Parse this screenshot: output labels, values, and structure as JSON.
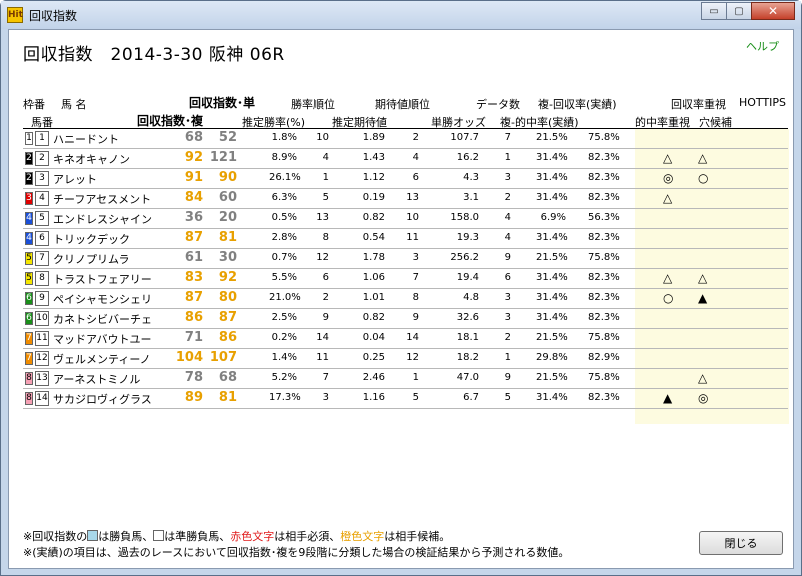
{
  "window": {
    "title": "回収指数",
    "app_icon_text": "Hit"
  },
  "header": {
    "title": "回収指数　2014-3-30 阪神 06R",
    "help": "ヘルプ"
  },
  "columns": {
    "waku": "枠番",
    "uma": "馬 名",
    "umaban": "馬番",
    "idx_single": "回収指数･単",
    "idx_place": "回収指数･複",
    "win_rank": "勝率順位",
    "exp_rank": "期待値順位",
    "data_count": "データ数",
    "place_return": "複-回収率(実績)",
    "est_win": "推定勝率(%)",
    "est_exp": "推定期待値",
    "win_odds": "単勝オッズ",
    "place_hit": "複-的中率(実績)",
    "return_focus": "回収率重視",
    "hit_focus": "的中率重視",
    "hottips": "HOTTIPS",
    "longshot": "穴候補"
  },
  "colors": {
    "orange": "#e8a000",
    "gray": "#808080",
    "red": "#e01a1a",
    "highlight_bg": "#fdfbe0"
  },
  "rows": [
    {
      "waku": "1",
      "uma": "1",
      "name": "ハニードント",
      "i1": "68",
      "i2": "52",
      "c1": "gray",
      "c2": "gray",
      "rate": "1.8%",
      "rk": "10",
      "exp": "1.89",
      "erk": "2",
      "odds": "107.7",
      "ork": "7",
      "fh": "21.5%",
      "wh": "75.8%",
      "m1": "",
      "m2": ""
    },
    {
      "waku": "2",
      "uma": "2",
      "name": "キネオキャノン",
      "i1": "92",
      "i2": "121",
      "c1": "orange",
      "c2": "gray",
      "rate": "8.9%",
      "rk": "4",
      "exp": "1.43",
      "erk": "4",
      "odds": "16.2",
      "ork": "1",
      "fh": "31.4%",
      "wh": "82.3%",
      "m1": "△",
      "m2": "△"
    },
    {
      "waku": "2",
      "uma": "3",
      "name": "アレット",
      "i1": "91",
      "i2": "90",
      "c1": "orange",
      "c2": "orange",
      "rate": "26.1%",
      "rk": "1",
      "exp": "1.12",
      "erk": "6",
      "odds": "4.3",
      "ork": "3",
      "fh": "31.4%",
      "wh": "82.3%",
      "m1": "◎",
      "m2": "○"
    },
    {
      "waku": "3",
      "uma": "4",
      "name": "チーフアセスメント",
      "i1": "84",
      "i2": "60",
      "c1": "orange",
      "c2": "gray",
      "rate": "6.3%",
      "rk": "5",
      "exp": "0.19",
      "erk": "13",
      "odds": "3.1",
      "ork": "2",
      "fh": "31.4%",
      "wh": "82.3%",
      "m1": "△",
      "m2": ""
    },
    {
      "waku": "4",
      "uma": "5",
      "name": "エンドレスシャイン",
      "i1": "36",
      "i2": "20",
      "c1": "gray",
      "c2": "gray",
      "rate": "0.5%",
      "rk": "13",
      "exp": "0.82",
      "erk": "10",
      "odds": "158.0",
      "ork": "4",
      "fh": "6.9%",
      "wh": "56.3%",
      "m1": "",
      "m2": ""
    },
    {
      "waku": "4",
      "uma": "6",
      "name": "トリックデック",
      "i1": "87",
      "i2": "81",
      "c1": "orange",
      "c2": "orange",
      "rate": "2.8%",
      "rk": "8",
      "exp": "0.54",
      "erk": "11",
      "odds": "19.3",
      "ork": "4",
      "fh": "31.4%",
      "wh": "82.3%",
      "m1": "",
      "m2": ""
    },
    {
      "waku": "5",
      "uma": "7",
      "name": "クリノプリムラ",
      "i1": "61",
      "i2": "30",
      "c1": "gray",
      "c2": "gray",
      "rate": "0.7%",
      "rk": "12",
      "exp": "1.78",
      "erk": "3",
      "odds": "256.2",
      "ork": "9",
      "fh": "21.5%",
      "wh": "75.8%",
      "m1": "",
      "m2": ""
    },
    {
      "waku": "5",
      "uma": "8",
      "name": "トラストフェアリー",
      "i1": "83",
      "i2": "92",
      "c1": "orange",
      "c2": "orange",
      "rate": "5.5%",
      "rk": "6",
      "exp": "1.06",
      "erk": "7",
      "odds": "19.4",
      "ork": "6",
      "fh": "31.4%",
      "wh": "82.3%",
      "m1": "△",
      "m2": "△"
    },
    {
      "waku": "6",
      "uma": "9",
      "name": "ペイシャモンシェリ",
      "i1": "87",
      "i2": "80",
      "c1": "orange",
      "c2": "orange",
      "rate": "21.0%",
      "rk": "2",
      "exp": "1.01",
      "erk": "8",
      "odds": "4.8",
      "ork": "3",
      "fh": "31.4%",
      "wh": "82.3%",
      "m1": "○",
      "m2": "▲"
    },
    {
      "waku": "6",
      "uma": "10",
      "name": "カネトシビバーチェ",
      "i1": "86",
      "i2": "87",
      "c1": "orange",
      "c2": "orange",
      "rate": "2.5%",
      "rk": "9",
      "exp": "0.82",
      "erk": "9",
      "odds": "32.6",
      "ork": "3",
      "fh": "31.4%",
      "wh": "82.3%",
      "m1": "",
      "m2": ""
    },
    {
      "waku": "7",
      "uma": "11",
      "name": "マッドアバウトユー",
      "i1": "71",
      "i2": "86",
      "c1": "gray",
      "c2": "orange",
      "rate": "0.2%",
      "rk": "14",
      "exp": "0.04",
      "erk": "14",
      "odds": "18.1",
      "ork": "2",
      "fh": "21.5%",
      "wh": "75.8%",
      "m1": "",
      "m2": ""
    },
    {
      "waku": "7",
      "uma": "12",
      "name": "ヴェルメンティーノ",
      "i1": "104",
      "i2": "107",
      "c1": "orange",
      "c2": "orange",
      "rate": "1.4%",
      "rk": "11",
      "exp": "0.25",
      "erk": "12",
      "odds": "18.2",
      "ork": "1",
      "fh": "29.8%",
      "wh": "82.9%",
      "m1": "",
      "m2": ""
    },
    {
      "waku": "8",
      "uma": "13",
      "name": "アーネストミノル",
      "i1": "78",
      "i2": "68",
      "c1": "gray",
      "c2": "gray",
      "rate": "5.2%",
      "rk": "7",
      "exp": "2.46",
      "erk": "1",
      "odds": "47.0",
      "ork": "9",
      "fh": "21.5%",
      "wh": "75.8%",
      "m1": "",
      "m2": "△"
    },
    {
      "waku": "8",
      "uma": "14",
      "name": "サカジロヴィグラス",
      "i1": "89",
      "i2": "81",
      "c1": "orange",
      "c2": "orange",
      "rate": "17.3%",
      "rk": "3",
      "exp": "1.16",
      "erk": "5",
      "odds": "6.7",
      "ork": "5",
      "fh": "31.4%",
      "wh": "82.3%",
      "m1": "▲",
      "m2": "◎"
    }
  ],
  "legend": {
    "l1_a": "※回収指数の",
    "l1_b": "は勝負馬、",
    "l1_c": "は準勝負馬、",
    "l1_red": "赤色文字",
    "l1_d": "は相手必須、",
    "l1_orange": "橙色文字",
    "l1_e": "は相手候補。",
    "l2": "※(実績)の項目は、過去のレースにおいて回収指数･複を9段階に分類した場合の検証結果から予測される数値。"
  },
  "close_button": "閉じる",
  "window_buttons": {
    "minimize": "▭",
    "maximize": "▢",
    "close": "✕"
  }
}
